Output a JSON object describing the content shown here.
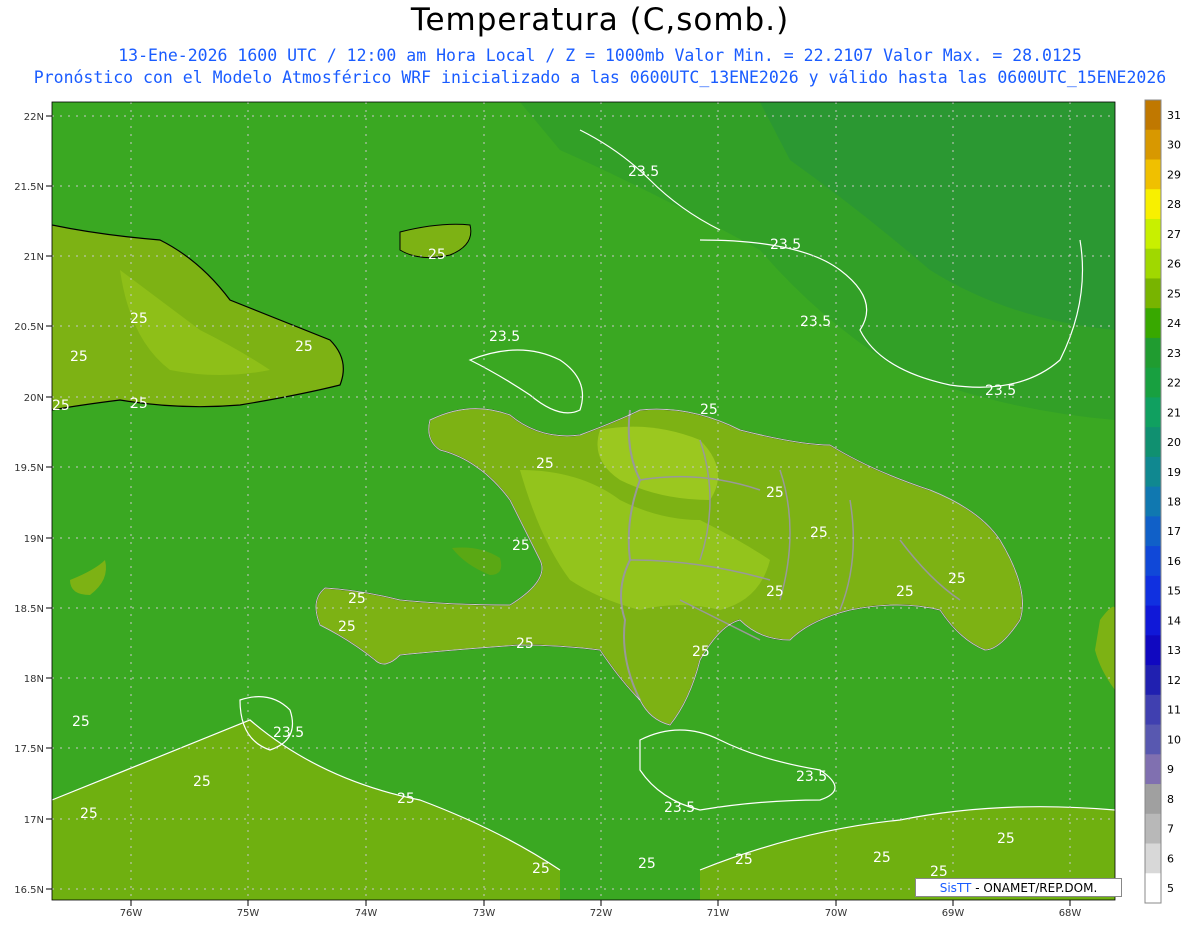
{
  "header": {
    "title": "Temperatura (C,somb.)",
    "line1": "13-Ene-2026 1600 UTC / 12:00 am Hora Local / Z = 1000mb  Valor Min. = 22.2107  Valor Max. = 28.0125",
    "line2": "Pronóstico con el Modelo Atmosférico WRF inicializado a las 0600UTC_13ENE2026 y válido hasta las  0600UTC_15ENE2026"
  },
  "axes": {
    "lat_labels": [
      "22N",
      "21.5N",
      "21N",
      "20.5N",
      "20N",
      "19.5N",
      "19N",
      "18.5N",
      "18N",
      "17.5N",
      "17N",
      "16.5N"
    ],
    "lon_labels": [
      "76W",
      "75W",
      "74W",
      "73W",
      "72W",
      "71W",
      "70W",
      "69W",
      "68W"
    ]
  },
  "contours": {
    "labels": [
      "23.5",
      "25"
    ]
  },
  "colorbar": {
    "ticks": [
      "31",
      "30",
      "29",
      "28",
      "27",
      "26",
      "25",
      "24",
      "23",
      "22",
      "21",
      "20",
      "19",
      "18",
      "17",
      "16",
      "15",
      "14",
      "13",
      "12",
      "11",
      "10",
      "9",
      "8",
      "7",
      "6",
      "5"
    ],
    "colors": [
      "#c07800",
      "#d89800",
      "#f0c000",
      "#f8f000",
      "#c8f000",
      "#a0d800",
      "#78b400",
      "#38a800",
      "#209c30",
      "#18a040",
      "#10a060",
      "#109070",
      "#108890",
      "#1078b0",
      "#1060c8",
      "#1048d8",
      "#1030e0",
      "#1018d8",
      "#1008c0",
      "#2020b0",
      "#4040b0",
      "#5858b0",
      "#8070b0",
      "#a0a0a0",
      "#b8b8b8",
      "#d8d8d8",
      "#ffffff"
    ]
  },
  "credit": {
    "brand": "SisTT",
    "text": "- ONAMET/REP.DOM."
  }
}
